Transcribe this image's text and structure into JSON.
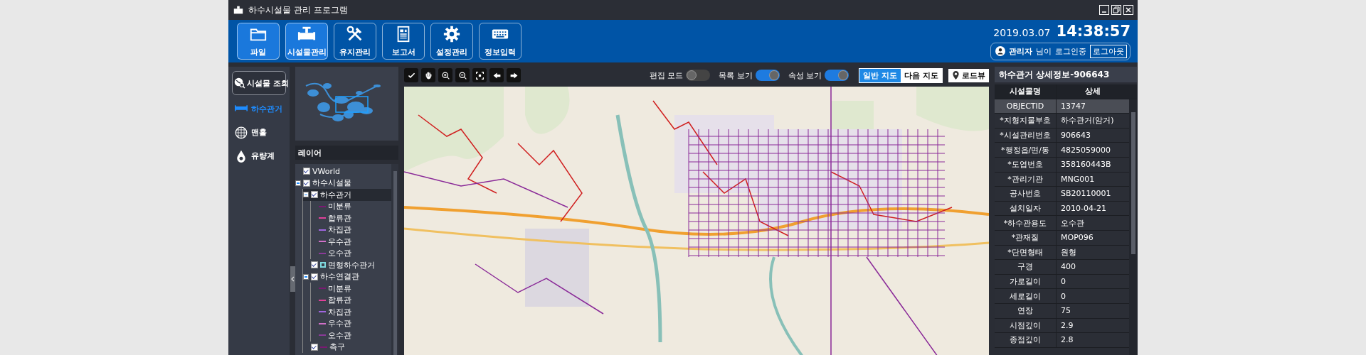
{
  "window": {
    "title": "하수시설물 관리 프로그램"
  },
  "toolbar": {
    "buttons": [
      {
        "label": "파일",
        "active": true
      },
      {
        "label": "시설물관리",
        "active": true
      },
      {
        "label": "유지관리",
        "active": false
      },
      {
        "label": "보고서",
        "active": false
      },
      {
        "label": "설정관리",
        "active": false
      },
      {
        "label": "정보입력",
        "active": false
      }
    ],
    "date": "2019.03.07",
    "time": "14:38:57",
    "user": {
      "name": "관리자",
      "suffix": "님이",
      "status": "로그인중",
      "logout": "로그아웃"
    }
  },
  "sidebar": {
    "search_button": "시설물 조회",
    "items": [
      {
        "label": "하수관거",
        "selected": true
      },
      {
        "label": "맨홀",
        "selected": false
      },
      {
        "label": "유량계",
        "selected": false
      }
    ]
  },
  "layers": {
    "title": "레이어",
    "tree": [
      {
        "label": "VWorld",
        "checked": true,
        "selected": false
      },
      {
        "label": "하수시설물",
        "checked": true,
        "expanded": true,
        "selected": false,
        "children": [
          {
            "label": "하수관거",
            "checked": true,
            "expanded": true,
            "selected": true,
            "children": [
              {
                "label": "미분류",
                "kind": "line",
                "color": "#7a1a72",
                "selected": false
              },
              {
                "label": "합류관",
                "kind": "line",
                "color": "#e0409a",
                "selected": false
              },
              {
                "label": "차집관",
                "kind": "line",
                "color": "#a066e0",
                "selected": false
              },
              {
                "label": "우수관",
                "kind": "line",
                "color": "#d070c8",
                "selected": false
              },
              {
                "label": "오수관",
                "kind": "line",
                "color": "#8a3a98",
                "selected": false
              }
            ]
          },
          {
            "label": "면형하수관거",
            "checked": true,
            "kind": "area",
            "color": "#7fd8de",
            "selected": false
          },
          {
            "label": "하수연결관",
            "checked": true,
            "expanded": true,
            "selected": false,
            "children": [
              {
                "label": "미분류",
                "kind": "line",
                "color": "#7a1a72",
                "selected": false
              },
              {
                "label": "합류관",
                "kind": "line",
                "color": "#e0409a",
                "selected": false
              },
              {
                "label": "차집관",
                "kind": "line",
                "color": "#a066e0",
                "selected": false
              },
              {
                "label": "우수관",
                "kind": "line",
                "color": "#d070c8",
                "selected": false
              },
              {
                "label": "오수관",
                "kind": "line",
                "color": "#8a3a98",
                "selected": false
              }
            ]
          },
          {
            "label": "측구",
            "checked": true,
            "kind": "line",
            "color": "#7a1a72",
            "selected": false
          }
        ]
      }
    ]
  },
  "map": {
    "toggles": [
      {
        "label": "편집 모드",
        "on": false
      },
      {
        "label": "목록 보기",
        "on": true
      },
      {
        "label": "속성 보기",
        "on": true
      }
    ],
    "map_types": [
      {
        "label": "일반 지도",
        "selected": true
      },
      {
        "label": "다음 지도",
        "selected": false
      }
    ],
    "roadview": "로드뷰"
  },
  "detail": {
    "title": "하수관거 상세정보-906643",
    "columns": [
      "시설물명",
      "상세"
    ],
    "rows": [
      {
        "name": "OBJECTID",
        "value": "13747",
        "selected": true
      },
      {
        "name": "*지형지물부호",
        "value": "하수관거(암거)",
        "selected": false
      },
      {
        "name": "*시설관리번호",
        "value": "906643",
        "selected": false
      },
      {
        "name": "*행정읍/면/동",
        "value": "4825059000",
        "selected": false
      },
      {
        "name": "*도엽번호",
        "value": "358160443B",
        "selected": false
      },
      {
        "name": "*관리기관",
        "value": "MNG001",
        "selected": false
      },
      {
        "name": "공사번호",
        "value": "SB20110001",
        "selected": false
      },
      {
        "name": "설치일자",
        "value": "2010-04-21",
        "selected": false
      },
      {
        "name": "*하수관용도",
        "value": "오수관",
        "selected": false
      },
      {
        "name": "*관재질",
        "value": "MOP096",
        "selected": false
      },
      {
        "name": "*단면형태",
        "value": "원형",
        "selected": false
      },
      {
        "name": "구경",
        "value": "400",
        "selected": false
      },
      {
        "name": "가로길이",
        "value": "0",
        "selected": false
      },
      {
        "name": "세로길이",
        "value": "0",
        "selected": false
      },
      {
        "name": "연장",
        "value": "75",
        "selected": false
      },
      {
        "name": "시점깊이",
        "value": "2.9",
        "selected": false
      },
      {
        "name": "종점깊이",
        "value": "2.8",
        "selected": false
      }
    ]
  }
}
